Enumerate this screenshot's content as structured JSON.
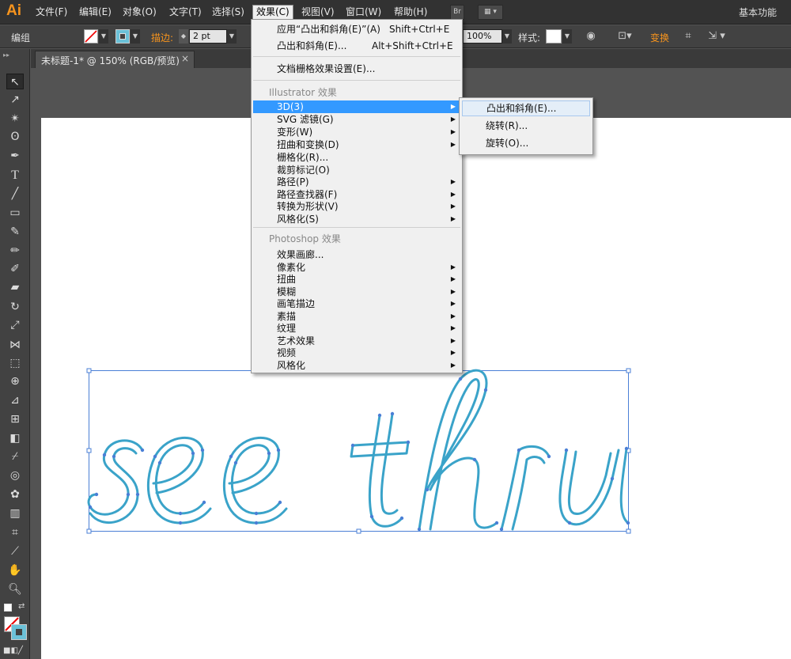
{
  "app": {
    "logo": "Ai",
    "workspace": "基本功能"
  },
  "menubar": {
    "items": [
      "文件(F)",
      "编辑(E)",
      "对象(O)",
      "文字(T)",
      "选择(S)",
      "效果(C)",
      "视图(V)",
      "窗口(W)",
      "帮助(H)"
    ],
    "active_index": 5,
    "bridge_label": "Br"
  },
  "controlbar": {
    "group_label": "编组",
    "stroke_label": "描边:",
    "stroke_value": "2 pt",
    "opacity_value": "100%",
    "style_label": "样式:",
    "transform_label": "变换"
  },
  "document": {
    "tab_title": "未标题-1* @ 150% (RGB/预览)",
    "close_glyph": "×"
  },
  "effect_menu": {
    "items": [
      {
        "label": "应用“凸出和斜角(E)”(A)",
        "shortcut": "Shift+Ctrl+E"
      },
      {
        "label": "凸出和斜角(E)...",
        "shortcut": "Alt+Shift+Ctrl+E"
      },
      {
        "label": "文档栅格效果设置(E)..."
      },
      {
        "label": "Illustrator 效果",
        "section": true
      },
      {
        "label": "3D(3)",
        "submenu": true,
        "highlighted": true
      },
      {
        "label": "SVG 滤镜(G)",
        "submenu": true
      },
      {
        "label": "变形(W)",
        "submenu": true
      },
      {
        "label": "扭曲和变换(D)",
        "submenu": true
      },
      {
        "label": "栅格化(R)..."
      },
      {
        "label": "裁剪标记(O)"
      },
      {
        "label": "路径(P)",
        "submenu": true
      },
      {
        "label": "路径查找器(F)",
        "submenu": true
      },
      {
        "label": "转换为形状(V)",
        "submenu": true
      },
      {
        "label": "风格化(S)",
        "submenu": true
      },
      {
        "label": "Photoshop 效果",
        "section": true
      },
      {
        "label": "效果画廊..."
      },
      {
        "label": "像素化",
        "submenu": true
      },
      {
        "label": "扭曲",
        "submenu": true
      },
      {
        "label": "模糊",
        "submenu": true
      },
      {
        "label": "画笔描边",
        "submenu": true
      },
      {
        "label": "素描",
        "submenu": true
      },
      {
        "label": "纹理",
        "submenu": true
      },
      {
        "label": "艺术效果",
        "submenu": true
      },
      {
        "label": "视频",
        "submenu": true
      },
      {
        "label": "风格化",
        "submenu": true
      }
    ]
  },
  "submenu_3d": {
    "items": [
      "凸出和斜角(E)...",
      "绕转(R)...",
      "旋转(O)..."
    ],
    "hover_index": 0
  },
  "artwork": {
    "text": "see thru",
    "stroke_color": "#3aa3c9",
    "selection_color": "#4a7fd6"
  },
  "colors": {
    "accent": "#3399ff",
    "logo": "#f7941d"
  }
}
